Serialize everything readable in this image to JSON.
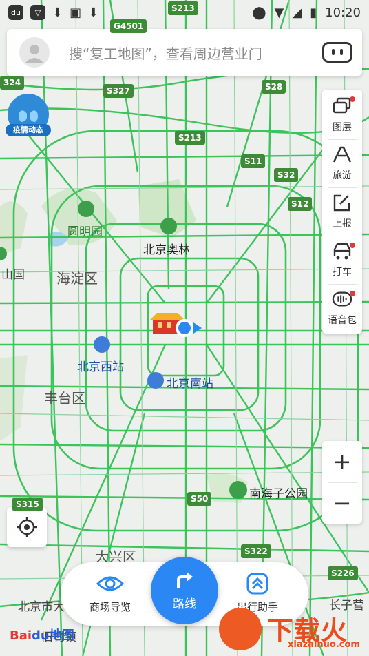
{
  "status_bar": {
    "time": "10:20",
    "left_icons": [
      "du-app-icon",
      "baidu-map-icon",
      "download-icon",
      "image-icon",
      "download-icon"
    ],
    "right_icons": [
      "location-icon",
      "wifi-icon",
      "signal-icon",
      "battery-charging-icon"
    ]
  },
  "search": {
    "placeholder": "搜“复工地图”，查看周边营业门",
    "avatar_icon": "user-avatar-icon",
    "assistant_icon": "voice-assistant-robot-icon"
  },
  "epidemic_badge": {
    "label": "疫情动态",
    "icon": "lungs-icon"
  },
  "tools": [
    {
      "label": "图层",
      "icon": "layers-icon",
      "dot": true
    },
    {
      "label": "旅游",
      "icon": "travel-icon",
      "dot": false
    },
    {
      "label": "上报",
      "icon": "report-icon",
      "dot": false
    },
    {
      "label": "打车",
      "icon": "taxi-icon",
      "dot": true
    },
    {
      "label": "语音包",
      "icon": "voice-pack-icon",
      "dot": true
    }
  ],
  "zoom": {
    "in": "+",
    "out": "−"
  },
  "map": {
    "places": {
      "yuanmingyuan": "圆明园",
      "beijing_aolin": "北京奥林",
      "haidian": "海淀区",
      "shanguo": "山国",
      "beijing_west": "北京西站",
      "beijing_south": "北京南站",
      "fengtai": "丰台区",
      "nanhaizi": "南海子公园",
      "daxing": "大兴区",
      "beijing_city": "北京市大",
      "zhen": "旧村镇",
      "changzi": "长子营"
    },
    "roads": [
      "S213",
      "G4501",
      "S327",
      "S28",
      "S213",
      "S11",
      "S32",
      "S12",
      "S315",
      "S50",
      "S322",
      "S226",
      "324"
    ]
  },
  "bottom_bar": {
    "left": {
      "label": "商场导览",
      "icon": "eye-icon"
    },
    "center": {
      "label": "路线",
      "icon": "turn-right-arrow-icon"
    },
    "right": {
      "label": "出行助手",
      "icon": "travel-assistant-icon"
    }
  },
  "logo": {
    "text_red": "Bai",
    "text_blue": "du地图"
  },
  "watermark": {
    "title": "下载火",
    "url": "xiazaihuo.com"
  },
  "colors": {
    "road": "#3cc35a",
    "accent": "#2b87f3",
    "watermark": "#ee4b1c"
  }
}
